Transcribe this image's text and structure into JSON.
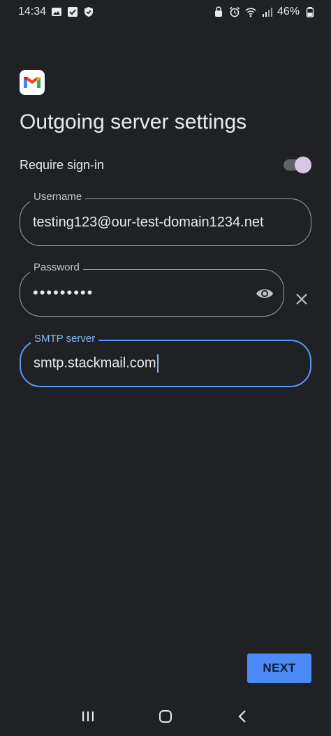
{
  "status_bar": {
    "time": "14:34",
    "battery": "46%"
  },
  "app": {
    "logo_icon": "gmail-logo-icon",
    "title": "Outgoing server settings"
  },
  "require_signin": {
    "label": "Require sign-in",
    "enabled": true
  },
  "fields": {
    "username": {
      "label": "Username",
      "value": "testing123@our-test-domain1234.net"
    },
    "password": {
      "label": "Password",
      "value": "•••••••••"
    },
    "smtp": {
      "label": "SMTP server",
      "value": "smtp.stackmail.com"
    }
  },
  "next_button": "NEXT",
  "colors": {
    "background": "#202124",
    "accent": "#4c8bf5",
    "focus_border": "#5e97f6",
    "toggle_thumb": "#d7c5e3"
  }
}
